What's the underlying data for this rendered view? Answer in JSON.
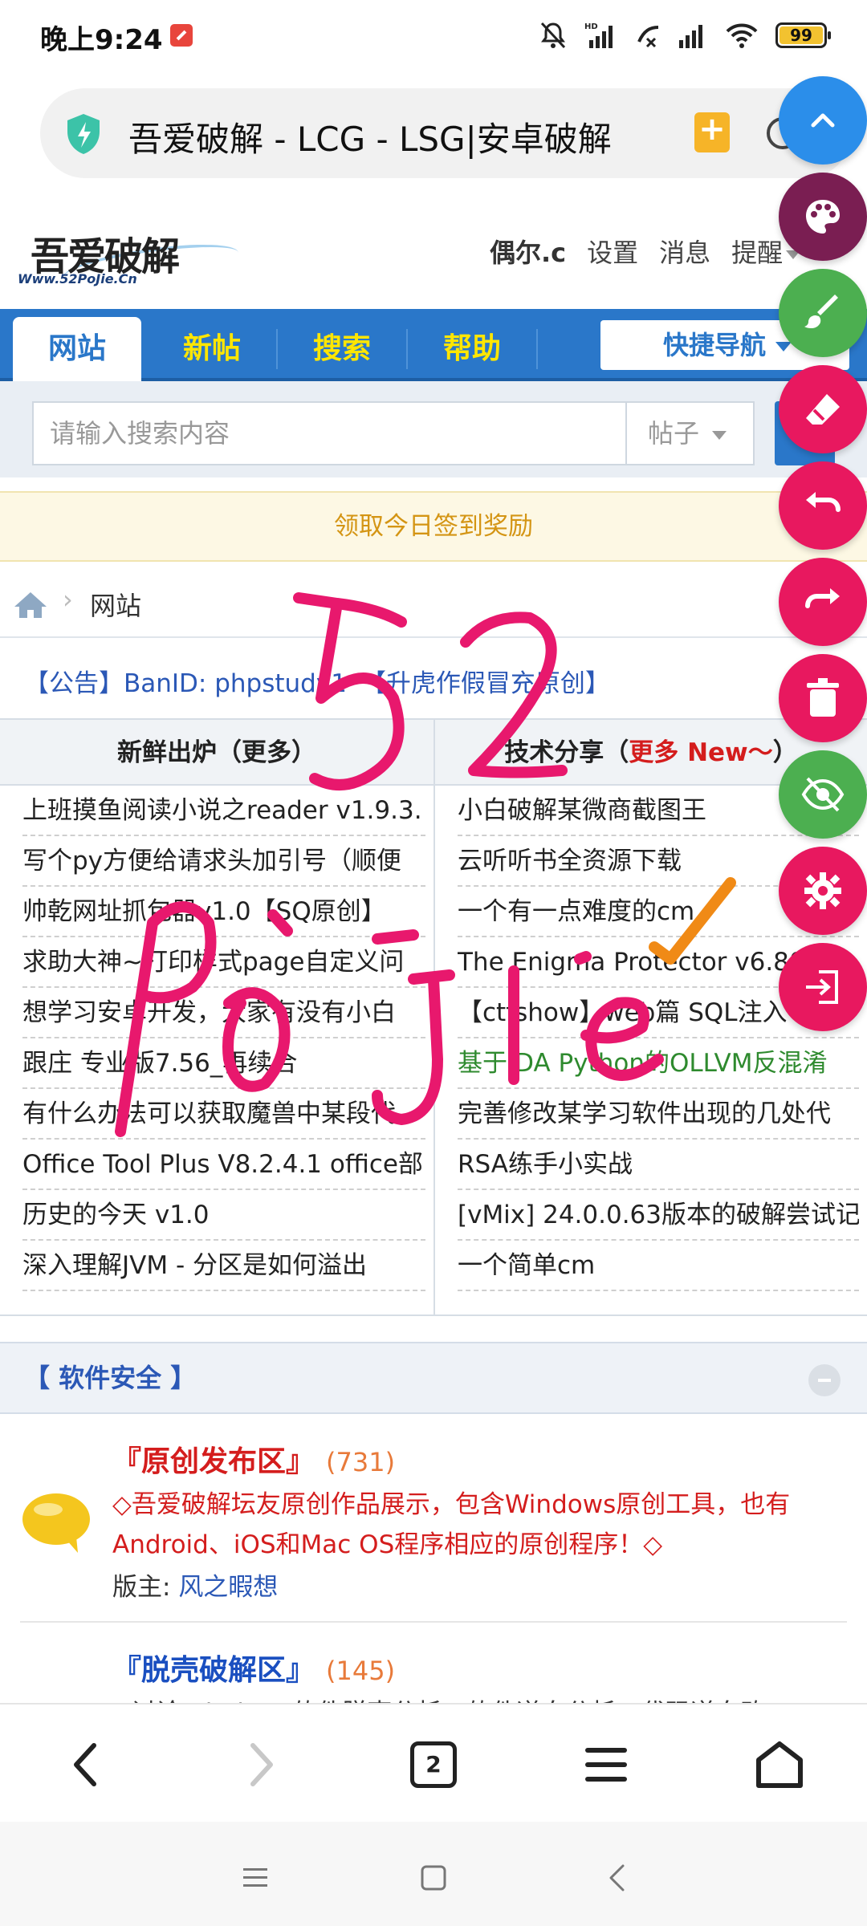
{
  "status_bar": {
    "time": "晚上9:24",
    "battery": "99"
  },
  "address_bar": {
    "url_text": "吾爱破解 - LCG - LSG|安卓破解"
  },
  "site_header": {
    "logo_main": "吾爱破解",
    "logo_url": "Www.52PoJie.Cn",
    "user_links": [
      "偶尔.c",
      "设置",
      "消息",
      "提醒"
    ]
  },
  "nav": {
    "tabs": [
      "网站",
      "新帖",
      "搜索",
      "帮助"
    ],
    "quick_nav": "快捷导航"
  },
  "search": {
    "placeholder": "请输入搜索内容",
    "type": "帖子"
  },
  "signin_banner": "领取今日签到奖励",
  "breadcrumb": {
    "current": "网站"
  },
  "announcement": {
    "part1": "【公告】BanID: phpstudy1",
    "part2": "【升虎作假冒充原创】"
  },
  "hot_lists": {
    "left": {
      "header": "新鲜出炉（更多）",
      "items": [
        "上班摸鱼阅读小说之reader v1.9.3.",
        "写个py方便给请求头加引号（顺便",
        "帅乾网址抓包器v1.0【SQ原创】",
        "求助大神~打印样式page自定义问",
        "想学习安卓开发，大家有没有小白",
        "跟庄 专业版7.56_再续合",
        "有什么办法可以获取魔兽中某段代",
        "Office Tool Plus V8.2.4.1 office部",
        "历史的今天 v1.0",
        "深入理解JVM - 分区是如何溢出"
      ]
    },
    "right": {
      "header_prefix": "技术分享（",
      "header_more": "更多 New～",
      "header_suffix": "）",
      "items": [
        "小白破解某微商截图王",
        "云听听书全资源下载",
        "一个有一点难度的cm",
        "The Enigma Protector v6.80",
        "【ctfshow】web篇 SQL注入",
        "基于IDA Python的OLLVM反混淆",
        "完善修改某学习软件出现的几处代",
        "RSA练手小实战",
        "[vMix] 24.0.0.63版本的破解尝试记",
        "一个简单cm"
      ]
    }
  },
  "section": {
    "title": "【 软件安全 】"
  },
  "forums": [
    {
      "name": "『原创发布区』",
      "count": "(731)",
      "desc": "◇吾爱破解坛友原创作品展示，包含Windows原创工具，也有Android、iOS和Mac OS程序相应的原创程序！◇",
      "mod_label": "版主:",
      "mod_name": "风之暇想"
    },
    {
      "name": "『脱壳破解区』",
      "count": "(145)",
      "desc": "◇讨论Windows软件脱壳分析、软件逆向分析、代码逆向改"
    }
  ],
  "browser_toolbar": {
    "tab_count": "2"
  },
  "colors": {
    "nav_blue": "#2a77c9",
    "nav_text_yellow": "#ffe600",
    "ink_magenta": "#e8186d",
    "ink_orange": "#f08a16",
    "fab_blue": "#2b8eea",
    "fab_purple": "#7a1e52",
    "fab_green": "#4caf50",
    "fab_pink": "#e8185f"
  },
  "drawing_tools": [
    "expand-icon",
    "palette-icon",
    "brush-icon",
    "eraser-icon",
    "undo-icon",
    "redo-icon",
    "trash-icon",
    "hide-icon",
    "settings-icon",
    "exit-icon"
  ]
}
